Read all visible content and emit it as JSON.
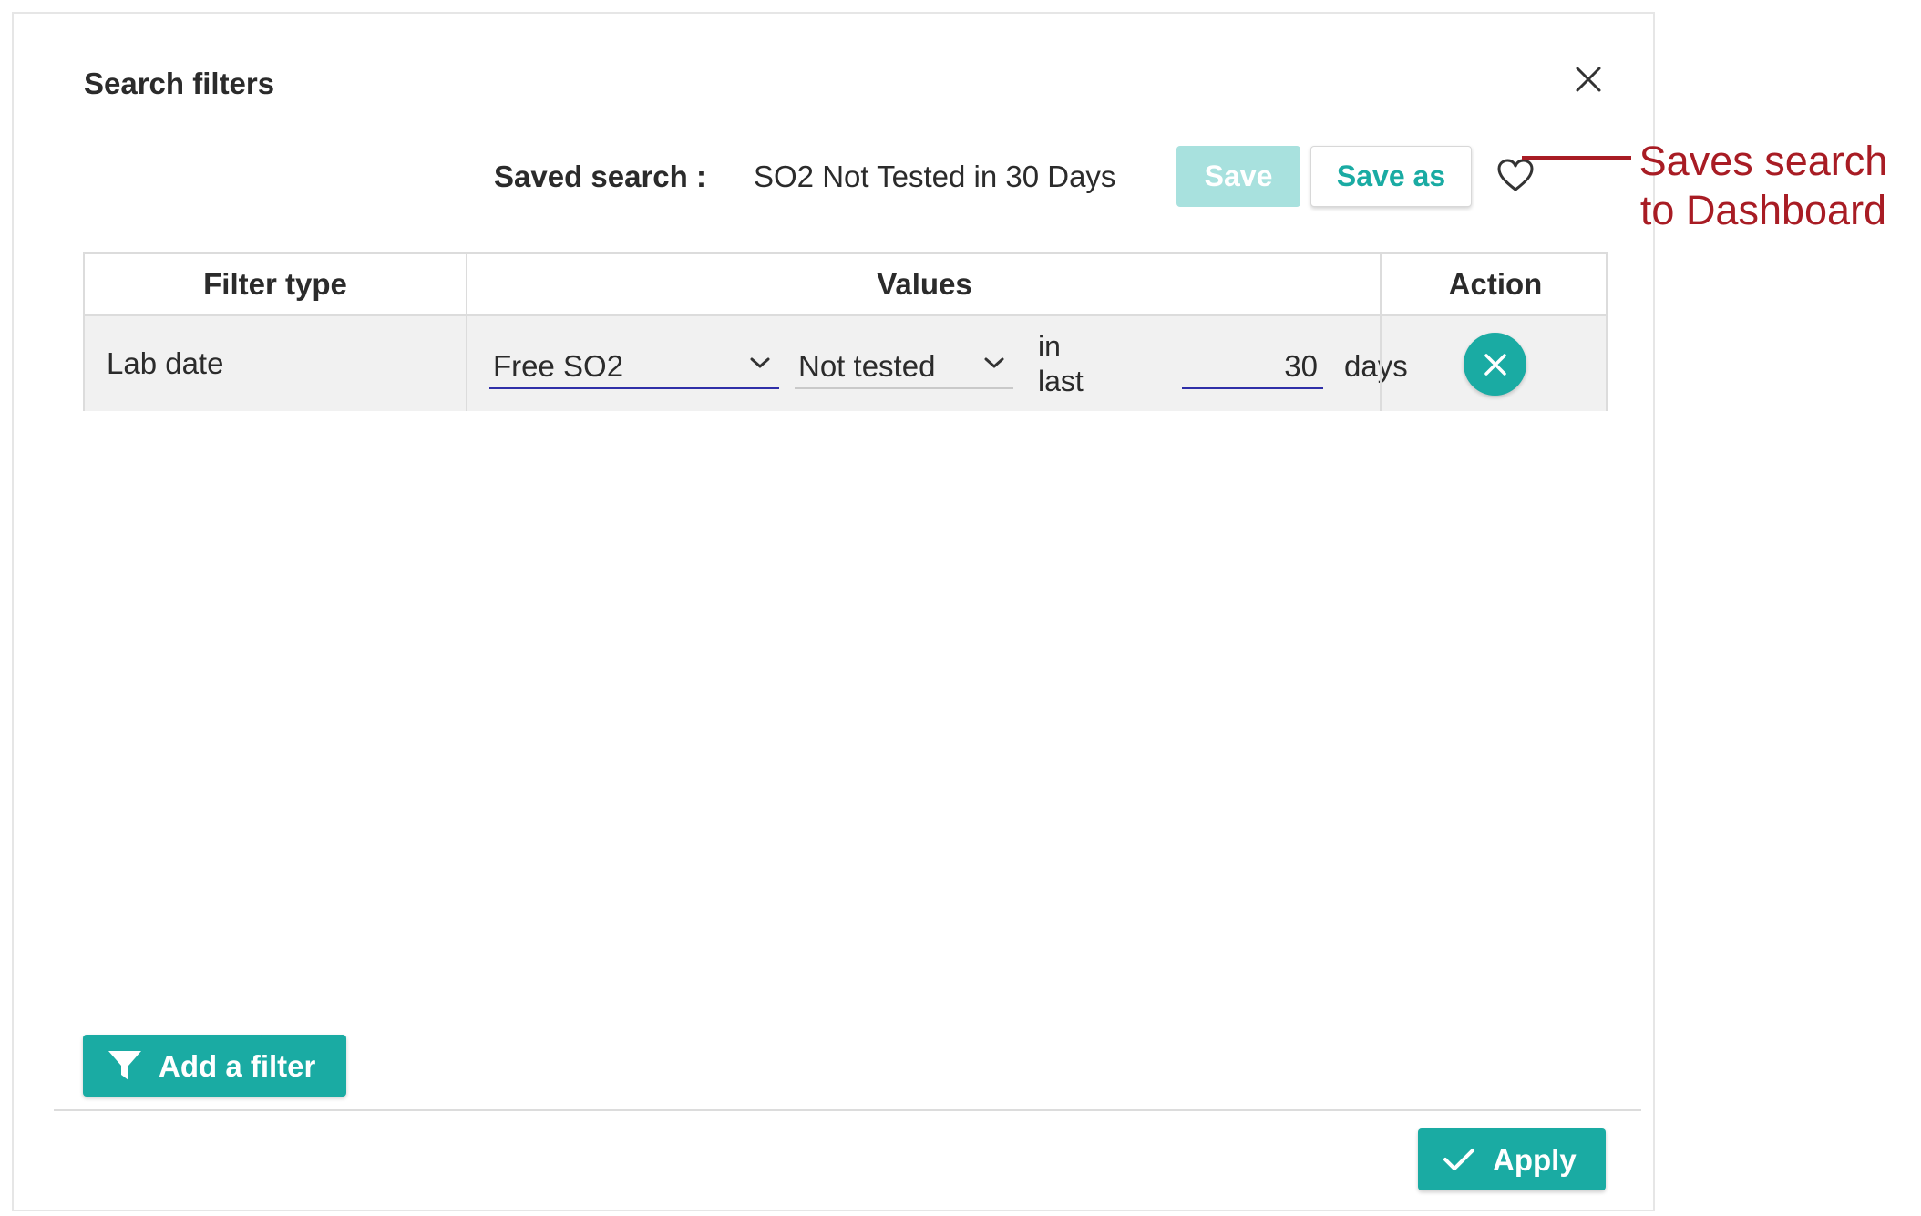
{
  "dialog": {
    "title": "Search filters"
  },
  "saved_search": {
    "label": "Saved search :",
    "name": "SO2 Not Tested in 30 Days",
    "save_label": "Save",
    "save_as_label": "Save as"
  },
  "annotation": {
    "line1": "Saves search",
    "line2": "to Dashboard",
    "color": "#a81c24"
  },
  "table": {
    "headers": [
      "Filter type",
      "Values",
      "Action"
    ],
    "rows": [
      {
        "filter_type": "Lab date",
        "parameter": "Free SO2",
        "condition": "Not tested",
        "in_last_1": "in",
        "in_last_2": "last",
        "days_value": "30",
        "days_label": "days"
      }
    ]
  },
  "footer": {
    "add_filter_label": "Add a filter",
    "apply_label": "Apply"
  },
  "icons": {
    "close": "close-icon",
    "favorite": "heart-icon",
    "dropdown": "chevron-down-icon",
    "remove": "close-icon",
    "add_filter": "funnel-icon",
    "apply": "check-icon"
  },
  "colors": {
    "accent": "#1aaba3",
    "accent_disabled": "#a8e1de",
    "input_underline": "#2f2fa8"
  }
}
